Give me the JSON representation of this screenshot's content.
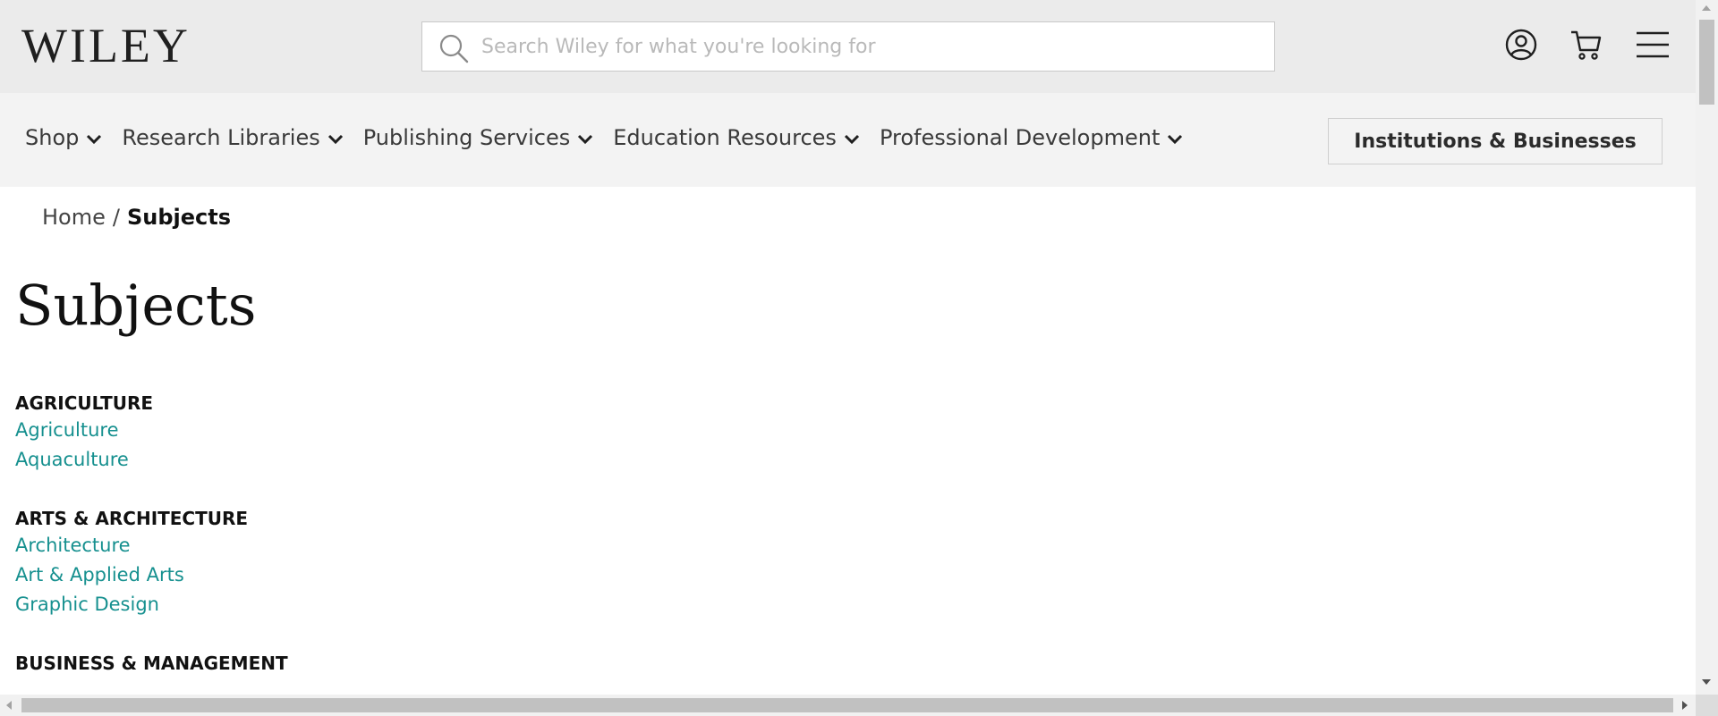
{
  "header": {
    "logo_text": "WILEY",
    "search_placeholder": "Search Wiley for what you're looking for",
    "icons": [
      "search-icon",
      "account-icon",
      "cart-icon",
      "menu-icon"
    ]
  },
  "nav": {
    "items": [
      {
        "label": "Shop"
      },
      {
        "label": "Research Libraries"
      },
      {
        "label": "Publishing Services"
      },
      {
        "label": "Education Resources"
      },
      {
        "label": "Professional Development"
      }
    ],
    "institutions_button": "Institutions & Businesses"
  },
  "breadcrumb": {
    "home": "Home",
    "separator": "/",
    "current": "Subjects"
  },
  "page_title": "Subjects",
  "sections": [
    {
      "heading": "AGRICULTURE",
      "links": [
        "Agriculture",
        "Aquaculture"
      ]
    },
    {
      "heading": "ARTS & ARCHITECTURE",
      "links": [
        "Architecture",
        "Art & Applied Arts",
        "Graphic Design"
      ]
    },
    {
      "heading": "BUSINESS & MANAGEMENT",
      "links": []
    }
  ],
  "colors": {
    "header_bg": "#ebebeb",
    "nav_bg": "#f3f3f3",
    "link_color": "#16908f",
    "text_dark": "#111111"
  }
}
